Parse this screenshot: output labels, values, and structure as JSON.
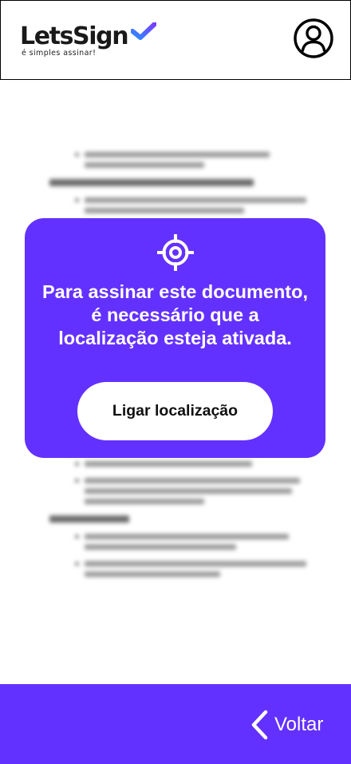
{
  "header": {
    "logo_text": "LetsSign",
    "logo_tagline": "é simples assinar!",
    "profile_icon": "user-circle-icon"
  },
  "modal": {
    "icon": "crosshair-location-icon",
    "message": "Para assinar este documento, é necessário que a localização esteja ativada.",
    "button_label": "Ligar localização"
  },
  "footer": {
    "back_icon": "chevron-left-icon",
    "back_label": "Voltar"
  },
  "colors": {
    "accent": "#6331ff",
    "logo_check_start": "#2d8cff",
    "logo_check_end": "#7b3cff",
    "background": "#ffffff"
  }
}
